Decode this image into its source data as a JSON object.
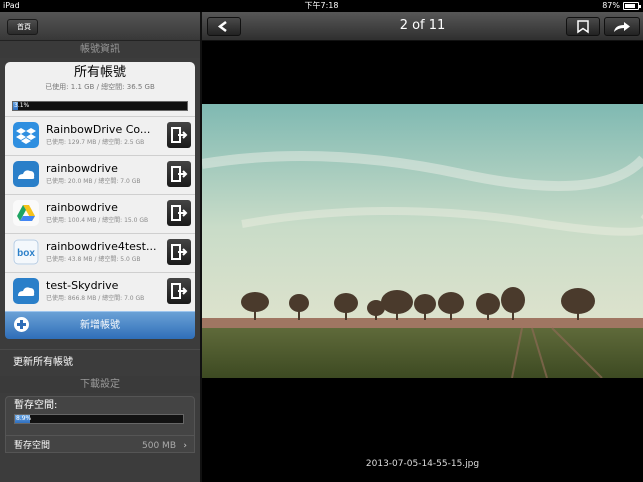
{
  "statusbar": {
    "device": "iPad",
    "time": "下午7:18",
    "battery": "87%"
  },
  "sidebar": {
    "home_label": "首頁",
    "account_section": "帳號資訊",
    "summary": {
      "title": "所有帳號",
      "usage": "已使用: 1.1 GB / 總空間: 36.5 GB",
      "percent_label": "3.1%",
      "percent": 3.1
    },
    "accounts": [
      {
        "name": "RainbowDrive Co...",
        "usage": "已使用: 129.7 MB / 總空間: 2.5 GB",
        "icon": "dropbox-icon"
      },
      {
        "name": "rainbowdrive",
        "usage": "已使用: 20.0 MB / 總空間: 7.0 GB",
        "icon": "skydrive-icon"
      },
      {
        "name": "rainbowdrive",
        "usage": "已使用: 100.4 MB / 總空間: 15.0 GB",
        "icon": "google-drive-icon"
      },
      {
        "name": "rainbowdrive4test...",
        "usage": "已使用: 43.8 MB / 總空間: 5.0 GB",
        "icon": "box-icon"
      },
      {
        "name": "test-Skydrive",
        "usage": "已使用: 866.8 MB / 總空間: 7.0 GB",
        "icon": "skydrive-icon"
      }
    ],
    "add_account": "新增帳號",
    "refresh_all": "更新所有帳號",
    "download_section": "下載設定",
    "cache_label": "暫存空間:",
    "cache_percent_label": "8.9%",
    "cache_percent": 8.9,
    "cache_row_label": "暫存空間",
    "cache_row_value": "500 MB"
  },
  "viewer": {
    "page_indicator": "2 of 11",
    "filename": "2013-07-05-14-55-15.jpg"
  }
}
